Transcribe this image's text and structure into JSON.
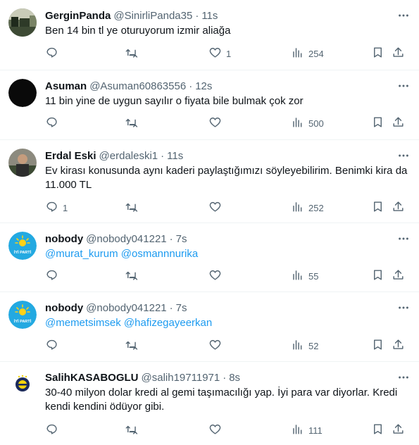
{
  "tweets": [
    {
      "name": "GerginPanda",
      "handle": "@SinirliPanda35",
      "dot": "·",
      "time": "11s",
      "text": "Ben 14 bin tl ye oturuyorum izmir aliağa",
      "mentions": [],
      "reply_count": "",
      "retweet_count": "",
      "like_count": "1",
      "views": "254",
      "avatar_icon": "photo-avatar"
    },
    {
      "name": "Asuman",
      "handle": "@Asuman60863556",
      "dot": "·",
      "time": "12s",
      "text": "11 bin yine de uygun sayılır o fiyata bile bulmak çok zor",
      "mentions": [],
      "reply_count": "",
      "retweet_count": "",
      "like_count": "",
      "views": "500",
      "avatar_icon": "black-circle-avatar"
    },
    {
      "name": "Erdal Eski",
      "handle": "@erdaleski1",
      "dot": "·",
      "time": "11s",
      "text": "Ev kirası konusunda aynı kaderi paylaştığımızı söyleyebilirim. Benimki kira da 11.000 TL",
      "mentions": [],
      "reply_count": "1",
      "retweet_count": "",
      "like_count": "",
      "views": "252",
      "avatar_icon": "photo-avatar"
    },
    {
      "name": "nobody",
      "handle": "@nobody041221",
      "dot": "·",
      "time": "7s",
      "text": "",
      "mentions": [
        "@murat_kurum",
        "@osmannnurika"
      ],
      "reply_count": "",
      "retweet_count": "",
      "like_count": "",
      "views": "55",
      "avatar_icon": "iyi-parti-logo",
      "avatar_text": "İYİ PARTİ"
    },
    {
      "name": "nobody",
      "handle": "@nobody041221",
      "dot": "·",
      "time": "7s",
      "text": "",
      "mentions": [
        "@memetsimsek",
        "@hafizegayeerkan"
      ],
      "reply_count": "",
      "retweet_count": "",
      "like_count": "",
      "views": "52",
      "avatar_icon": "iyi-parti-logo",
      "avatar_text": "İYİ PARTİ"
    },
    {
      "name": "SalihKASABOGLU",
      "handle": "@salih19711971",
      "dot": "·",
      "time": "8s",
      "text": "30-40 milyon dolar kredi al gemi taşımacılığı yap. İyi para var diyorlar. Kredi kendi kendini ödüyor gibi.",
      "mentions": [],
      "reply_count": "",
      "retweet_count": "",
      "like_count": "",
      "views": "111",
      "avatar_icon": "club-emblem-avatar"
    }
  ],
  "colors": {
    "link": "#1d9bf0",
    "muted": "#536471",
    "text": "#0f1419",
    "divider": "#eff3f4"
  },
  "icons": [
    "reply-icon",
    "retweet-icon",
    "like-icon",
    "views-icon",
    "bookmark-icon",
    "share-icon",
    "more-icon"
  ]
}
